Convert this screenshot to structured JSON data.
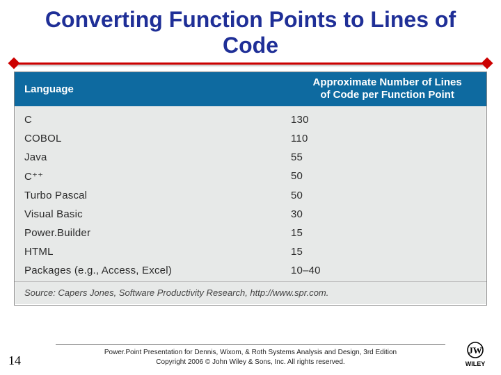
{
  "title": "Converting Function Points to Lines of Code",
  "chart_data": {
    "type": "table",
    "title": "Approximate Number of Lines of Code per Function Point",
    "columns": [
      "Language",
      "Approximate Number of Lines of Code per Function Point"
    ],
    "rows": [
      {
        "language": "C",
        "loc": "130"
      },
      {
        "language": "COBOL",
        "loc": "110"
      },
      {
        "language": "Java",
        "loc": "55"
      },
      {
        "language": "C⁺⁺",
        "loc": "50"
      },
      {
        "language": "Turbo Pascal",
        "loc": "50"
      },
      {
        "language": "Visual Basic",
        "loc": "30"
      },
      {
        "language": "Power.Builder",
        "loc": "15"
      },
      {
        "language": "HTML",
        "loc": "15"
      },
      {
        "language": "Packages (e.g., Access, Excel)",
        "loc": "10–40"
      }
    ],
    "source": "Source: Capers Jones, Software Productivity Research, http://www.spr.com."
  },
  "table_header": {
    "language": "Language",
    "loc_line1": "Approximate Number of Lines",
    "loc_line2": "of Code per Function Point"
  },
  "footer": {
    "line1": "Power.Point Presentation for Dennis, Wixom, & Roth Systems Analysis and Design, 3rd Edition",
    "line2": "Copyright 2006 © John Wiley & Sons, Inc.  All rights reserved."
  },
  "page_number": "14",
  "logo_label": "WILEY"
}
